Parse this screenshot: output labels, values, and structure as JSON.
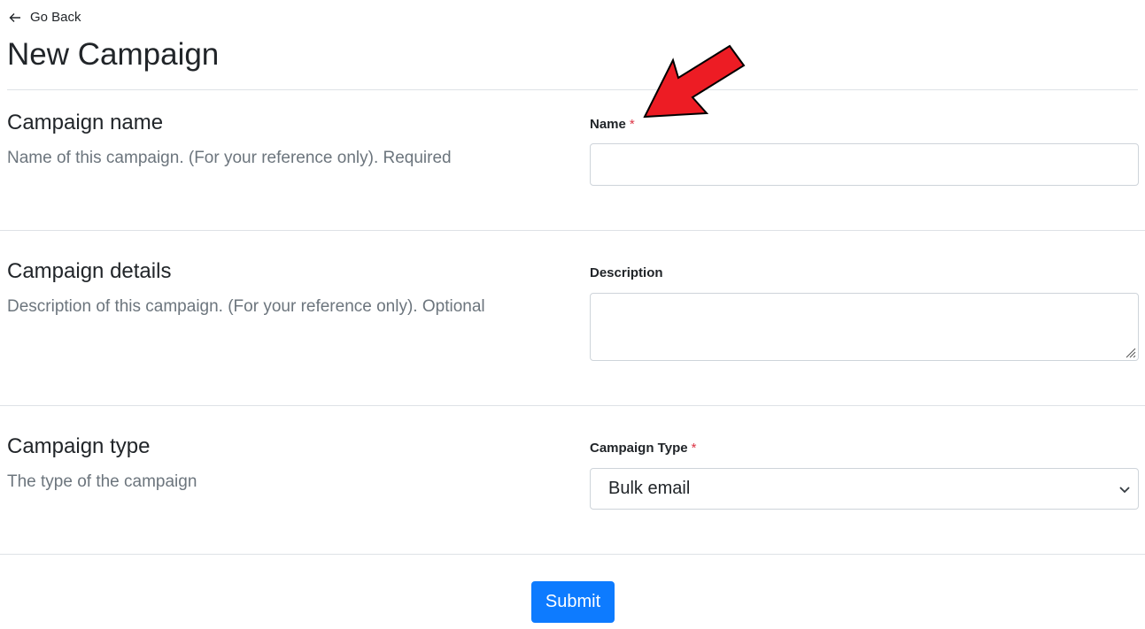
{
  "header": {
    "back_label": "Go Back",
    "title": "New Campaign"
  },
  "sections": [
    {
      "title": "Campaign name",
      "description": "Name of this campaign. (For your reference only). Required",
      "field_label": "Name",
      "required_mark": "*",
      "value": ""
    },
    {
      "title": "Campaign details",
      "description": "Description of this campaign. (For your reference only). Optional",
      "field_label": "Description",
      "value": ""
    },
    {
      "title": "Campaign type",
      "description": "The type of the campaign",
      "field_label": "Campaign Type",
      "required_mark": "*",
      "selected": "Bulk email"
    }
  ],
  "actions": {
    "submit_label": "Submit"
  },
  "colors": {
    "primary": "#0d7bff",
    "required": "#dc3545",
    "muted": "#6c757d",
    "annotation": "#ed1c24"
  },
  "icons": [
    "arrow-left-icon",
    "chevron-down-icon",
    "resize-grip-icon",
    "red-annotation-arrow-icon"
  ]
}
